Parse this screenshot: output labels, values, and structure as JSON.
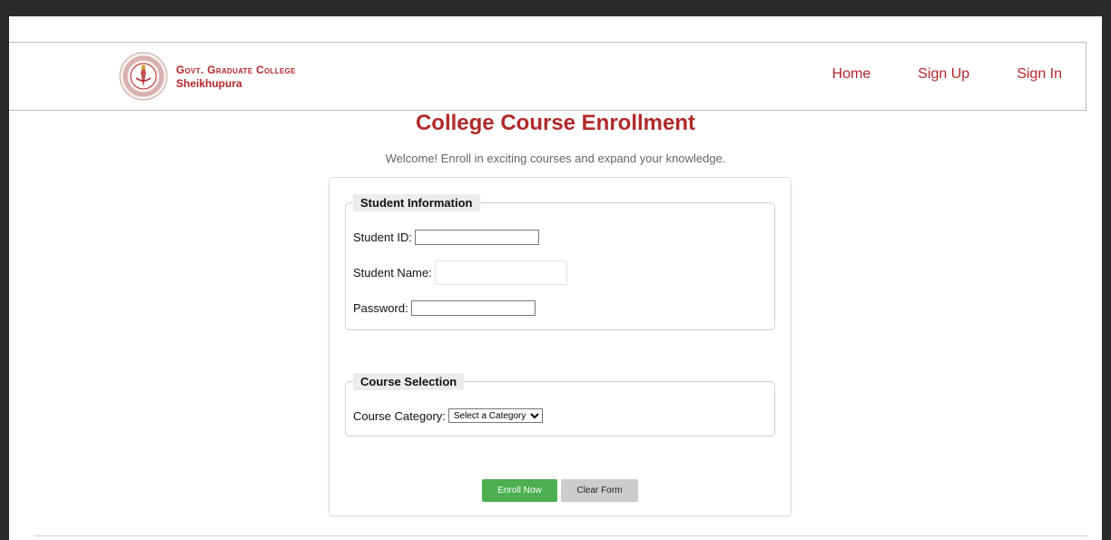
{
  "header": {
    "college_name": "Govt. Graduate College",
    "college_city": "Sheikhupura",
    "nav": {
      "home": "Home",
      "sign_up": "Sign Up",
      "sign_in": "Sign In"
    }
  },
  "main": {
    "title": "College Course Enrollment",
    "subtitle": "Welcome! Enroll in exciting courses and expand your knowledge."
  },
  "student_info": {
    "legend": "Student Information",
    "student_id_label": "Student ID:",
    "student_id_value": "",
    "student_name_label": "Student Name:",
    "student_name_value": "",
    "password_label": "Password:",
    "password_value": ""
  },
  "course_selection": {
    "legend": "Course Selection",
    "category_label": "Course Category:",
    "category_selected": "Select a Category"
  },
  "buttons": {
    "enroll": "Enroll Now",
    "clear": "Clear Form"
  },
  "colors": {
    "accent": "#b5252a",
    "enroll_button": "#4caf50",
    "clear_button": "#cccccc"
  },
  "icons": {
    "logo": "college-crest-icon",
    "select_arrow": "chevron-down-icon"
  }
}
